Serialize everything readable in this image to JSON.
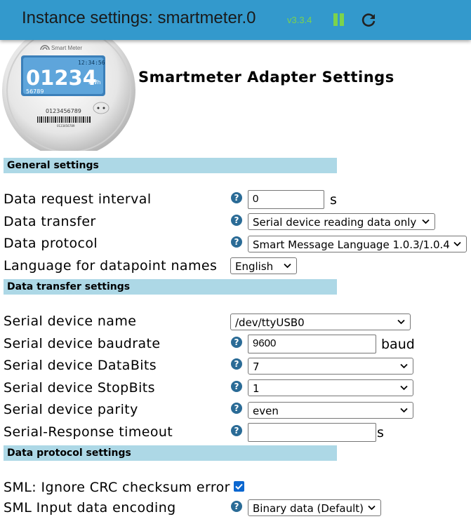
{
  "header": {
    "title": "Instance settings: smartmeter.0",
    "version": "v3.3.4"
  },
  "logo": {
    "brand": "Smart Meter",
    "time": "12:34:56",
    "reading": "01234",
    "unit": "kWh",
    "sub_number": "56789",
    "meter_id": "0123456789",
    "barcode_number": "0123456789"
  },
  "page_heading": "Smartmeter Adapter Settings",
  "sections": {
    "general": "General settings",
    "transfer": "Data transfer settings",
    "protocol": "Data protocol settings"
  },
  "general": {
    "interval_label": "Data request interval",
    "interval_value": "0",
    "interval_unit": "s",
    "transfer_label": "Data transfer",
    "transfer_value": "Serial device reading data only",
    "protocol_label": "Data protocol",
    "protocol_value": "Smart Message Language 1.0.3/1.0.4",
    "language_label": "Language for datapoint names",
    "language_value": "English"
  },
  "transfer": {
    "device_name_label": "Serial device name",
    "device_name_value": "/dev/ttyUSB0",
    "baudrate_label": "Serial device baudrate",
    "baudrate_value": "9600",
    "baudrate_unit": "baud",
    "databits_label": "Serial device DataBits",
    "databits_value": "7",
    "stopbits_label": "Serial device StopBits",
    "stopbits_value": "1",
    "parity_label": "Serial device parity",
    "parity_value": "even",
    "timeout_label": "Serial-Response timeout",
    "timeout_value": "",
    "timeout_unit": "s"
  },
  "protocol": {
    "crc_label": "SML: Ignore CRC checksum error",
    "crc_checked": true,
    "encoding_label": "SML Input data encoding",
    "encoding_value": "Binary data (Default)"
  },
  "colors": {
    "header_bg": "#3399cc",
    "version_green": "#7cd34c",
    "section_bg": "#add8e6",
    "help_icon": "#2a6b96",
    "checkbox": "#0b67d0"
  }
}
